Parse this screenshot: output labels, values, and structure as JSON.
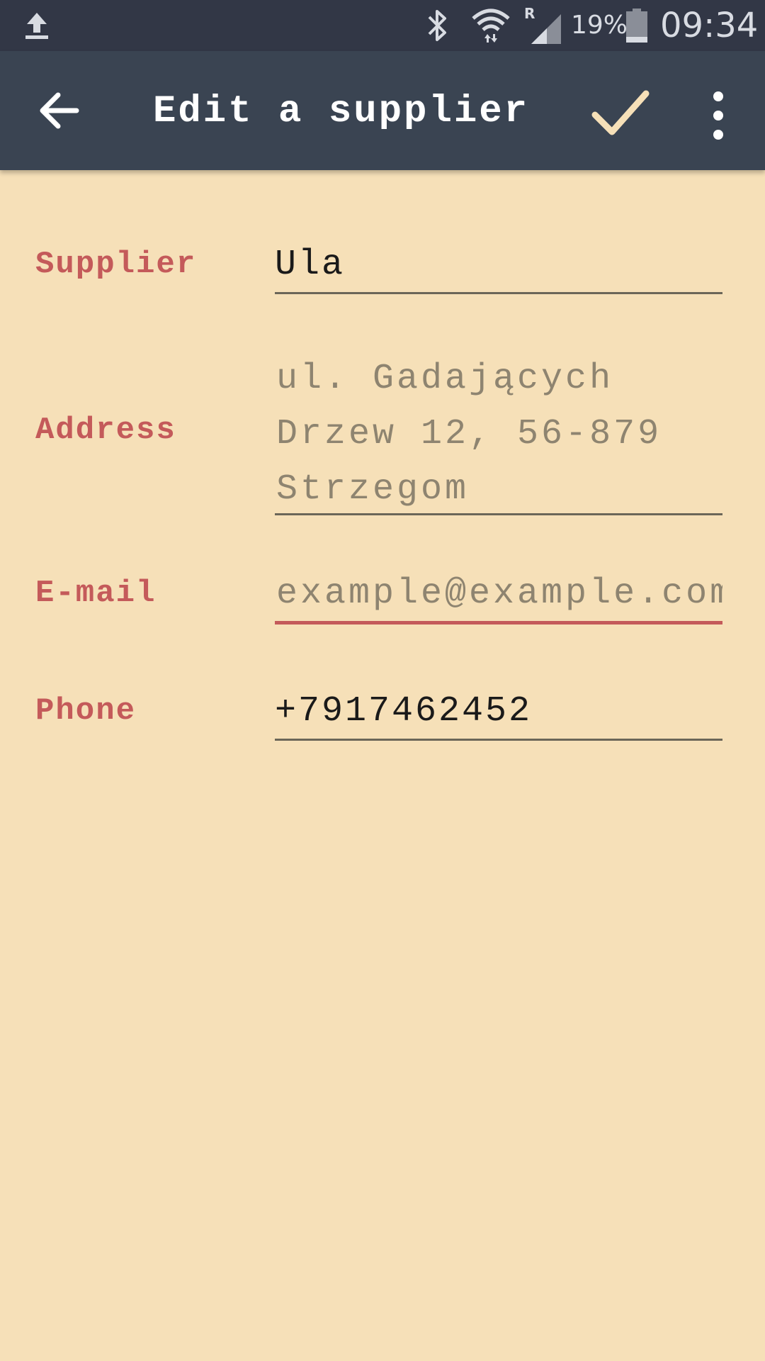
{
  "status_bar": {
    "battery_percent": "19%",
    "time": "09:34",
    "icons": [
      "upload-icon",
      "bluetooth-icon",
      "wifi-icon",
      "roaming-signal-icon",
      "battery-icon"
    ]
  },
  "toolbar": {
    "title": "Edit a supplier",
    "icons": [
      "back-arrow-icon",
      "check-icon",
      "more-vert-icon"
    ]
  },
  "form": {
    "supplier": {
      "label": "Supplier",
      "value": "Ula"
    },
    "address": {
      "label": "Address",
      "value": "ul. Gadających\nDrzew 12, 56-879\nStrzegom"
    },
    "email": {
      "label": "E-mail",
      "placeholder": "example@example.com"
    },
    "phone": {
      "label": "Phone",
      "value": "+7917462452"
    }
  },
  "colors": {
    "background": "#F6E0B8",
    "status_bar": "#323746",
    "toolbar": "#3A4452",
    "label": "#C45A5A",
    "check_icon": "#F6E0B8"
  }
}
